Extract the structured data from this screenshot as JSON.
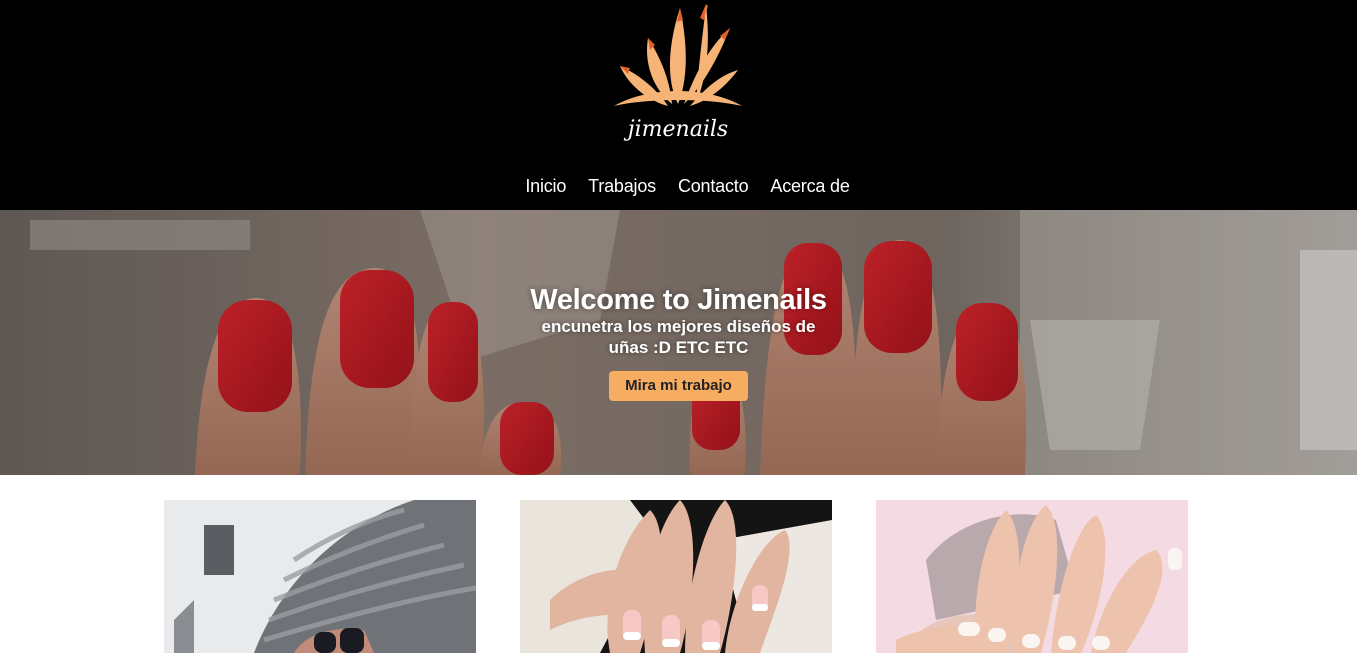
{
  "brand": {
    "logo_text": "jimenails",
    "colors": {
      "accent": "#f6ad61",
      "leaf_tip": "#e0602a",
      "header_bg": "#000000"
    }
  },
  "nav": {
    "items": [
      {
        "label": "Inicio"
      },
      {
        "label": "Trabajos"
      },
      {
        "label": "Contacto"
      },
      {
        "label": "Acerca de"
      }
    ]
  },
  "hero": {
    "title": "Welcome to Jimenails",
    "subtitle": "encunetra los mejores diseños de uñas :D ETC ETC",
    "button_label": "Mira mi trabajo"
  },
  "gallery": {
    "cards": [
      {
        "icon": "nail-photo-dark-glitter"
      },
      {
        "icon": "nail-photo-french-pink"
      },
      {
        "icon": "nail-photo-white-pastel"
      }
    ]
  }
}
